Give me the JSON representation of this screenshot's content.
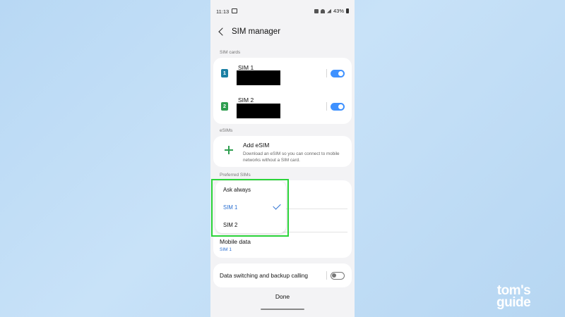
{
  "status_bar": {
    "time": "11:13",
    "battery": "43%"
  },
  "header": {
    "title": "SIM manager"
  },
  "sim_cards": {
    "label": "SIM cards",
    "items": [
      {
        "badge": "1",
        "name": "SIM 1",
        "enabled": true,
        "badge_color": "#1a7fa3"
      },
      {
        "badge": "2",
        "name": "SIM 2",
        "enabled": true,
        "badge_color": "#2e9e4f"
      }
    ]
  },
  "esims": {
    "label": "eSIMs",
    "add_title": "Add eSIM",
    "add_description": "Download an eSIM so you can connect to mobile networks without a SIM card."
  },
  "preferred_sims": {
    "label": "Preferred SIMs",
    "mobile_data_title": "Mobile data",
    "mobile_data_value": "SIM 1"
  },
  "dropdown": {
    "options": [
      "Ask always",
      "SIM 1",
      "SIM 2"
    ],
    "selected": "SIM 1"
  },
  "data_switching": {
    "label": "Data switching and backup calling",
    "enabled": false
  },
  "footer": {
    "done_label": "Done"
  },
  "watermark": {
    "line1": "tom's",
    "line2": "guide"
  },
  "colors": {
    "accent": "#3e91ff",
    "highlight": "#2bd43a",
    "background": "#f3f3f5"
  }
}
